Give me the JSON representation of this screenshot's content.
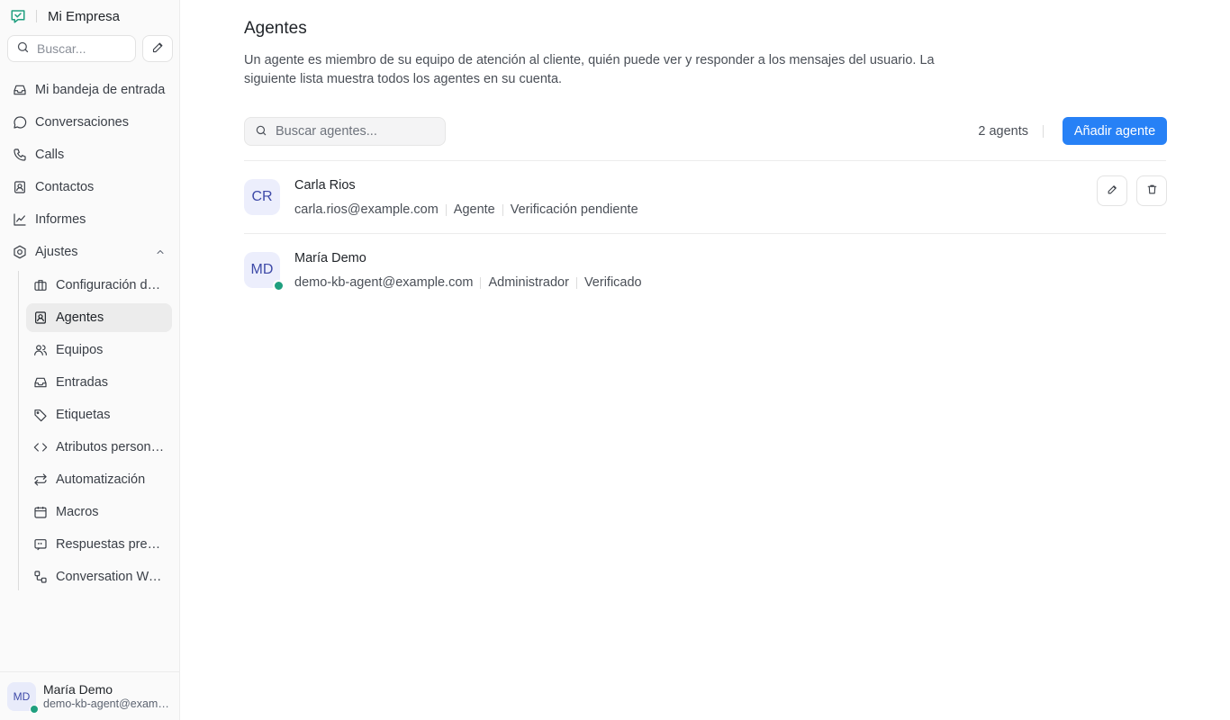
{
  "brand": {
    "name": "Mi Empresa"
  },
  "sidebar": {
    "search_placeholder": "Buscar...",
    "nav": [
      {
        "label": "Mi bandeja de entrada",
        "icon": "inbox-icon"
      },
      {
        "label": "Conversaciones",
        "icon": "chat-bubble-icon"
      },
      {
        "label": "Calls",
        "icon": "phone-icon"
      },
      {
        "label": "Contactos",
        "icon": "contact-card-icon"
      },
      {
        "label": "Informes",
        "icon": "chart-line-icon"
      },
      {
        "label": "Ajustes",
        "icon": "settings-hexagon-icon"
      }
    ],
    "settings": [
      {
        "label": "Configuración de la cuenta",
        "icon": "briefcase-icon"
      },
      {
        "label": "Agentes",
        "icon": "user-square-icon"
      },
      {
        "label": "Equipos",
        "icon": "users-icon"
      },
      {
        "label": "Entradas",
        "icon": "inbox-icon"
      },
      {
        "label": "Etiquetas",
        "icon": "tag-icon"
      },
      {
        "label": "Atributos personalizados",
        "icon": "code-icon"
      },
      {
        "label": "Automatización",
        "icon": "arrows-swap-icon"
      },
      {
        "label": "Macros",
        "icon": "calendar-icon"
      },
      {
        "label": "Respuestas predefinidas",
        "icon": "quote-message-icon"
      },
      {
        "label": "Conversation Workflows",
        "icon": "workflow-icon"
      }
    ]
  },
  "user": {
    "initials": "MD",
    "name": "María Demo",
    "email": "demo-kb-agent@example.com"
  },
  "page": {
    "title": "Agentes",
    "description": "Un agente es miembro de su equipo de atención al cliente, quién puede ver y responder a los mensajes del usuario. La siguiente lista muestra todos los agentes en su cuenta.",
    "search_placeholder": "Buscar agentes...",
    "count": "2 agents",
    "add_button": "Añadir agente"
  },
  "agents": [
    {
      "initials": "CR",
      "name": "Carla Rios",
      "email": "carla.rios@example.com",
      "role": "Agente",
      "status": "Verificación pendiente",
      "online": false
    },
    {
      "initials": "MD",
      "name": "María Demo",
      "email": "demo-kb-agent@example.com",
      "role": "Administrador",
      "status": "Verificado",
      "online": true
    }
  ],
  "colors": {
    "accent": "#2781f6",
    "online": "#1f9f7f",
    "brand_logo": "#1f9f7f"
  }
}
